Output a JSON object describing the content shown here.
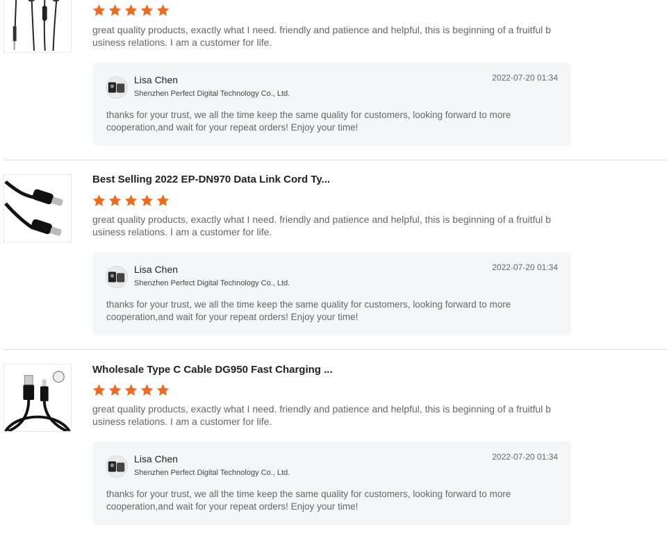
{
  "reviews": [
    {
      "product_title": "",
      "image_icon": "earphones-icon",
      "rating": 5,
      "comment": "great quality products, exactly what I need. friendly and patience and helpful, this is beginning of a fruitful business relations. I am a customer for life.",
      "reply": {
        "name": "Lisa Chen",
        "company": "Shenzhen Perfect Digital Technology Co., Ltd.",
        "date": "2022-07-20 01:34",
        "text": "thanks for your trust, we all the time keep the same quality for customers, looking forward to more cooperation,and wait for your repeat orders! Enjoy your time!"
      }
    },
    {
      "product_title": "Best Selling 2022 EP-DN970 Data Link Cord Ty...",
      "image_icon": "usb-c-cable-icon",
      "rating": 5,
      "comment": "great quality products, exactly what I need. friendly and patience and helpful, this is beginning of a fruitful business relations. I am a customer for life.",
      "reply": {
        "name": "Lisa Chen",
        "company": "Shenzhen Perfect Digital Technology Co., Ltd.",
        "date": "2022-07-20 01:34",
        "text": "thanks for your trust, we all the time keep the same quality for customers, looking forward to more cooperation,and wait for your repeat orders! Enjoy your time!"
      }
    },
    {
      "product_title": "Wholesale Type C Cable DG950 Fast Charging ...",
      "image_icon": "usb-a-to-c-cable-icon",
      "rating": 5,
      "comment": "great quality products, exactly what I need. friendly and patience and helpful, this is beginning of a fruitful business relations. I am a customer for life.",
      "reply": {
        "name": "Lisa Chen",
        "company": "Shenzhen Perfect Digital Technology Co., Ltd.",
        "date": "2022-07-20 01:34",
        "text": "thanks for your trust, we all the time keep the same quality for customers, looking forward to more cooperation,and wait for your repeat orders! Enjoy your time!"
      }
    }
  ],
  "colors": {
    "star": "#f06a1e",
    "reply_bg": "#f5f6f8",
    "divider": "#dcdcdc"
  }
}
